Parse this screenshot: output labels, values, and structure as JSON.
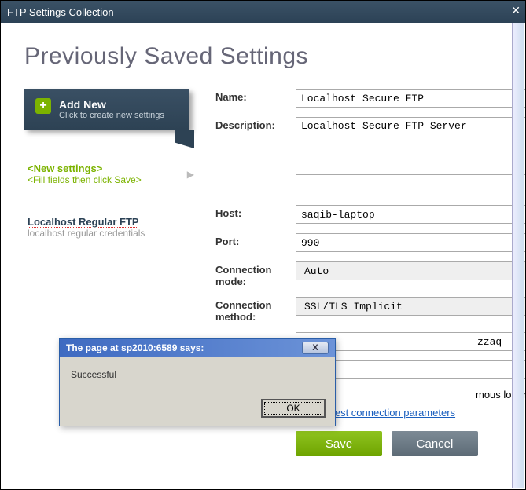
{
  "titlebar": {
    "title": "FTP Settings Collection"
  },
  "heading": "Previously Saved Settings",
  "sidebar": {
    "addnew": {
      "title": "Add New",
      "sub": "Click to create new settings"
    },
    "newsettings": {
      "title": "<New settings>",
      "sub": "<Fill fields then click Save>"
    },
    "existing": {
      "title": "Localhost Regular FTP",
      "sub": "localhost regular credentials"
    }
  },
  "form": {
    "labels": {
      "name": "Name:",
      "description": "Description:",
      "host": "Host:",
      "port": "Port:",
      "connmode": "Connection mode:",
      "connmethod": "Connection method:"
    },
    "values": {
      "name": "Localhost Secure FTP",
      "description": "Localhost Secure FTP Server",
      "host": "saqib-laptop",
      "port": "990",
      "connmode": "Auto",
      "connmethod": "SSL/TLS Implicit",
      "user_partial": "zzaq",
      "password": ""
    },
    "anon_label": "mous logon",
    "testlink": "Click to test connection parameters",
    "buttons": {
      "save": "Save",
      "cancel": "Cancel"
    }
  },
  "alert": {
    "title": "The page at sp2010:6589 says:",
    "body": "Successful",
    "ok": "OK",
    "close": "X"
  }
}
